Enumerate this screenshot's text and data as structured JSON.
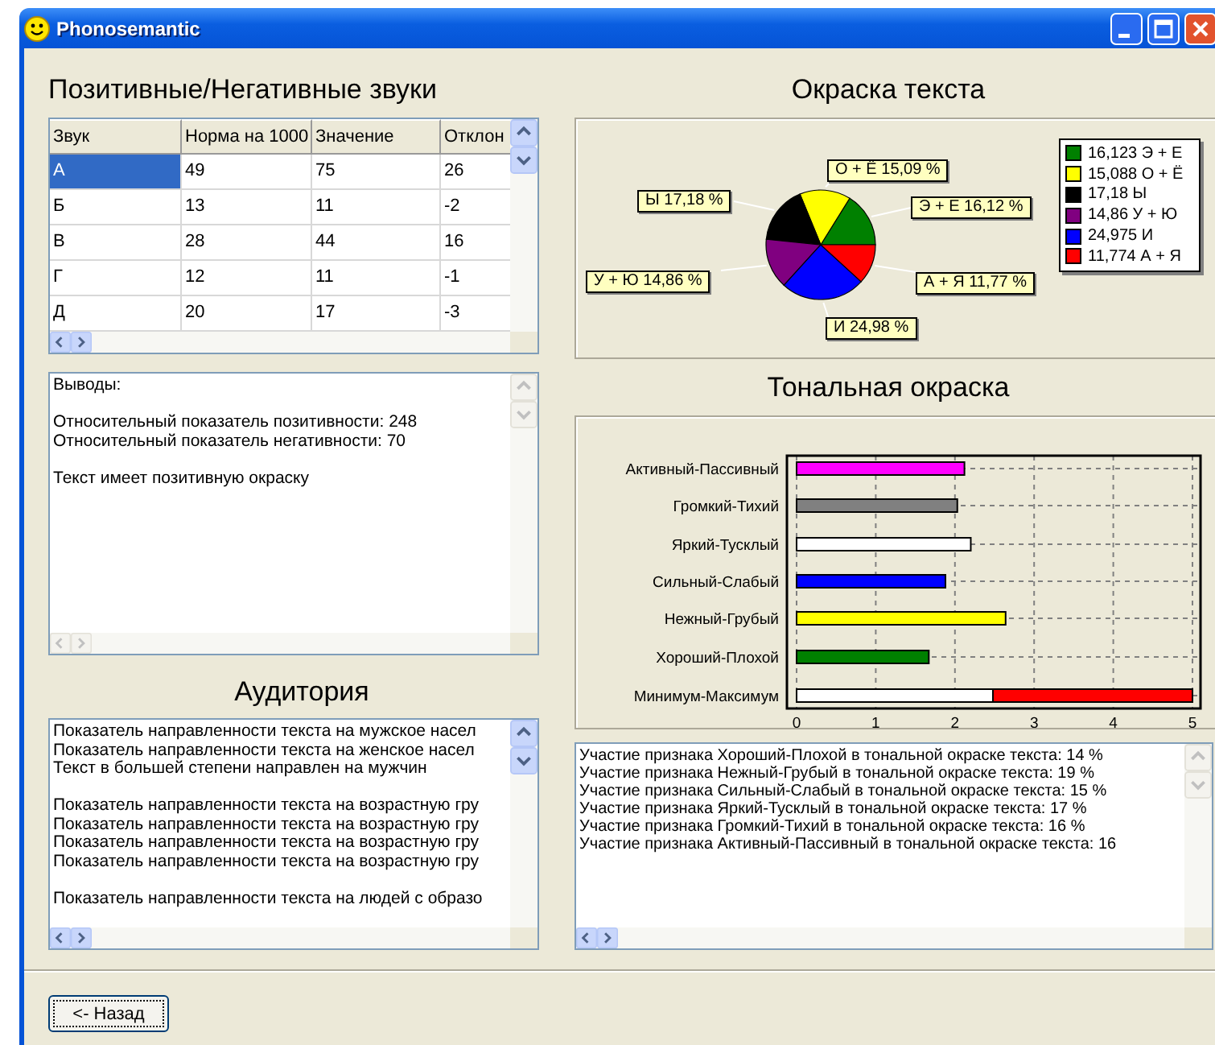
{
  "window": {
    "title": "Phonosemantic"
  },
  "sounds": {
    "title": "Позитивные/Негативные звуки",
    "columns": [
      "Звук",
      "Норма на 1000",
      "Значение",
      "Отклон"
    ],
    "rows": [
      {
        "cells": [
          "А",
          "49",
          "75",
          "26"
        ],
        "selected": true
      },
      {
        "cells": [
          "Б",
          "13",
          "11",
          "-2"
        ],
        "selected": false
      },
      {
        "cells": [
          "В",
          "28",
          "44",
          "16"
        ],
        "selected": false
      },
      {
        "cells": [
          "Г",
          "12",
          "11",
          "-1"
        ],
        "selected": false
      },
      {
        "cells": [
          "Д",
          "20",
          "17",
          "-3"
        ],
        "selected": false
      }
    ]
  },
  "conclusions": {
    "scroll_enabled": false,
    "paragraphs": [
      [
        "Выводы:"
      ],
      [
        "Относительный показатель позитивности: 248",
        "Относительный показатель негативности: 70"
      ],
      [
        "Текст имеет позитивную окраску"
      ]
    ]
  },
  "audience": {
    "title": "Аудитория",
    "scroll_enabled": true,
    "paragraphs": [
      [
        "Показатель направленности текста на мужское насел",
        "Показатель направленности текста на женское насел",
        "Текст в большей степени направлен на мужчин"
      ],
      [
        "Показатель направленности текста на возрастную гру",
        "Показатель направленности текста на возрастную гру",
        "Показатель направленности текста на возрастную гру",
        "Показатель направленности текста на возрастную гру"
      ],
      [
        "Показатель направленности текста на людей с образо"
      ]
    ]
  },
  "coloring": {
    "title": "Окраска текста",
    "slices": [
      {
        "label_value": "16,12 %",
        "legend_value": "16,123",
        "color": "#008000"
      },
      {
        "label_value": "15,09 %",
        "legend_value": "15,088",
        "color": "#ffff00"
      },
      {
        "label_value": "17,18 %",
        "legend_value": "17,18",
        "color": "#000000"
      },
      {
        "label_value": "14,86 %",
        "legend_value": "14,86",
        "color": "#800080"
      },
      {
        "label_value": "24,98 %",
        "legend_value": "24,975",
        "color": "#0000ff"
      },
      {
        "label_value": "11,77 %",
        "legend_value": "11,774",
        "color": "#ff0000"
      }
    ],
    "chart_data": {
      "type": "pie",
      "categories": [
        "Э + Е",
        "О + Ё",
        "Ы",
        "У + Ю",
        "И",
        "А + Я"
      ],
      "values": [
        16.123,
        15.088,
        17.18,
        14.86,
        24.975,
        11.774
      ]
    }
  },
  "tonal": {
    "title": "Тональная окраска",
    "chart_data": {
      "type": "bar",
      "orientation": "horizontal",
      "stacked": true,
      "categories": [
        "Активный-Пассивный",
        "Громкий-Тихий",
        "Яркий-Тусклый",
        "Сильный-Слабый",
        "Нежный-Грубый",
        "Хороший-Плохой",
        "Минимум-Максимум"
      ],
      "series": [
        {
          "colors": [
            "#ff00ff",
            "#808080",
            "#ffffff",
            "#0000ff",
            "#ffff00",
            "#008000",
            "#ffffff"
          ],
          "values": [
            2.12,
            2.03,
            2.2,
            1.88,
            2.64,
            1.67,
            2.48
          ]
        },
        {
          "color": "#ff0000",
          "values": [
            null,
            null,
            null,
            null,
            null,
            null,
            2.52
          ]
        }
      ],
      "xlim": [
        0,
        5
      ],
      "xticks": [
        0,
        1,
        2,
        3,
        4,
        5
      ],
      "grid": true
    },
    "scroll_enabled": true,
    "lines": [
      "Участие признака Хороший-Плохой в тональной окраске текста: 14 %",
      "Участие признака Нежный-Грубый в тональной окраске текста: 19 %",
      "Участие признака Сильный-Слабый в тональной окраске текста: 15 %",
      "Участие признака Яркий-Тусклый в тональной окраске текста: 17 %",
      "Участие признака Громкий-Тихий в тональной окраске текста: 16 %",
      "Участие признака Активный-Пассивный в тональной окраске текста: 16"
    ]
  },
  "back_button": "<- Назад"
}
